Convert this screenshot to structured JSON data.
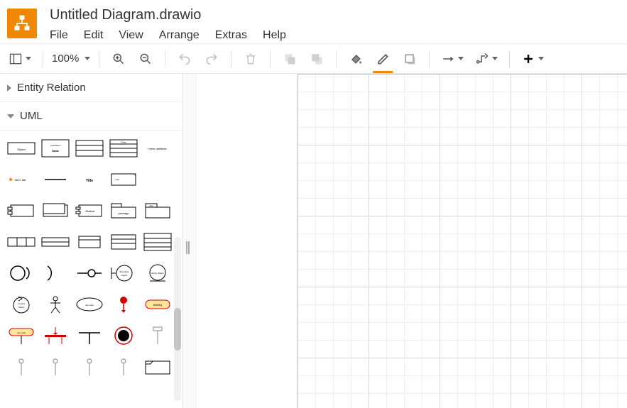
{
  "header": {
    "title": "Untitled Diagram.drawio",
    "menus": [
      "File",
      "Edit",
      "View",
      "Arrange",
      "Extras",
      "Help"
    ]
  },
  "toolbar": {
    "zoom": "100%"
  },
  "sidebar": {
    "sections": [
      {
        "name": "Entity Relation",
        "expanded": false
      },
      {
        "name": "UML",
        "expanded": true
      }
    ],
    "shapes": [
      "object",
      "interface",
      "class-3row",
      "class-4row",
      "item-attribute",
      "item-attribute-orange",
      "divider",
      "title",
      "note-corner",
      "blank",
      "component-bar",
      "component",
      "module",
      "package",
      "package-tab",
      "table-3col-a",
      "table-3col-b",
      "list-small",
      "list-medium",
      "list-large",
      "circle-partial",
      "arc",
      "lollipop-horizontal",
      "boundary-object",
      "entity-object",
      "control-object",
      "actor",
      "ellipse-label",
      "start-node",
      "activity-pill",
      "usecase-line",
      "fork-horizontal",
      "tee",
      "end-node",
      "lifeline-top",
      "lifeline-a",
      "lifeline-b",
      "lifeline-c",
      "lifeline-d",
      "frame"
    ]
  }
}
